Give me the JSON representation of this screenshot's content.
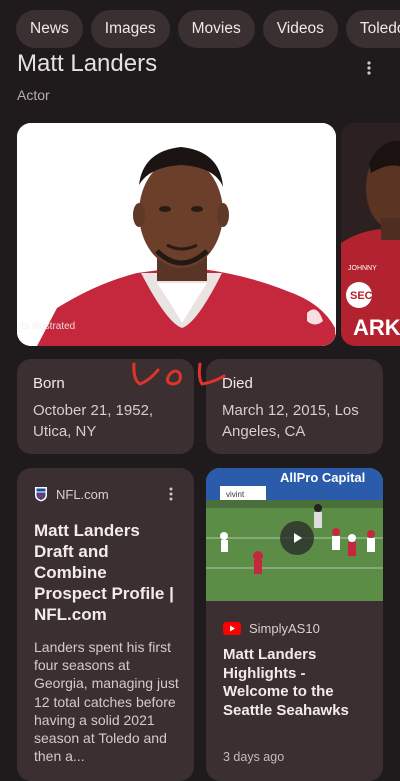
{
  "chips": [
    "News",
    "Images",
    "Movies",
    "Videos",
    "Toledo"
  ],
  "entity": {
    "name": "Matt Landers",
    "type": "Actor"
  },
  "photo": {
    "credit": "rts Illustrated",
    "side_text_top": "JOHNNY",
    "side_text_logo": "SEC",
    "side_text_bottom": "ARK"
  },
  "facts": [
    {
      "label": "Born",
      "value": "October 21, 1952, Utica, NY"
    },
    {
      "label": "Died",
      "value": "March 12, 2015, Los Angeles, CA"
    }
  ],
  "annotation": {
    "text": "lol",
    "color": "#e0332b"
  },
  "article": {
    "source": "NFL.com",
    "title": "Matt Landers Draft and Combine Prospect Profile | NFL.com",
    "snippet": "Landers spent his first four seasons at Georgia, managing just 12 total catches before having a solid 2021 season at Toledo and then a..."
  },
  "video": {
    "source": "SimplyAS10",
    "title": "Matt Landers Highlights - Welcome to the Seattle Seahawks",
    "age": "3 days ago",
    "ad_board_1": "vivint",
    "ad_board_2": "AllPro Capital"
  },
  "colors": {
    "background": "#1f1b1c",
    "card": "#3b2f31",
    "chip": "#3a2f31",
    "youtube_red": "#ff0000",
    "jersey_red": "#c5283d"
  }
}
